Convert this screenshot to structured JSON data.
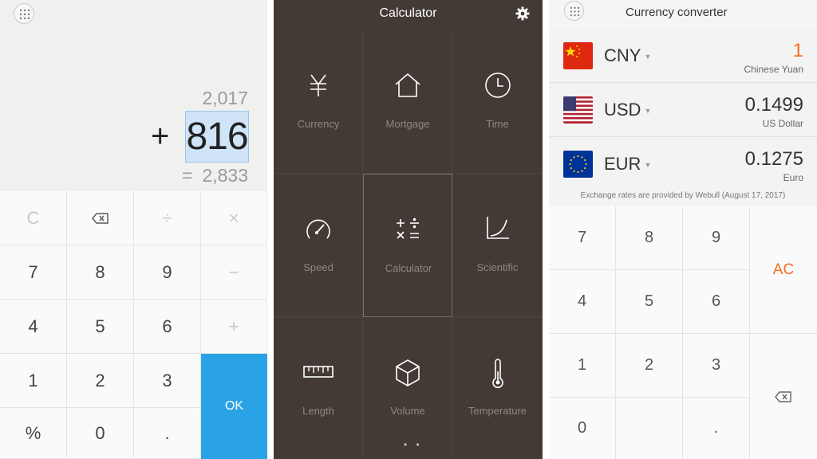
{
  "calculator": {
    "menu_icon": "grid-dots-icon",
    "previous_value": "2,017",
    "operator": "+",
    "current_input": "816",
    "result_prefix": "=",
    "result": "2,833",
    "keys": {
      "clear": "C",
      "backspace_icon": "backspace-icon",
      "divide": "÷",
      "multiply": "×",
      "seven": "7",
      "eight": "8",
      "nine": "9",
      "minus": "−",
      "four": "4",
      "five": "5",
      "six": "6",
      "plus": "+",
      "one": "1",
      "two": "2",
      "three": "3",
      "percent": "%",
      "zero": "0",
      "dot": ".",
      "ok": "OK"
    },
    "accent_color": "#29a3e6"
  },
  "tools": {
    "title": "Calculator",
    "settings_icon": "gear-icon",
    "items": [
      {
        "label": "Currency",
        "icon": "yen-icon"
      },
      {
        "label": "Mortgage",
        "icon": "house-icon"
      },
      {
        "label": "Time",
        "icon": "clock-icon"
      },
      {
        "label": "Speed",
        "icon": "speedometer-icon"
      },
      {
        "label": "Calculator",
        "icon": "calculator-icon"
      },
      {
        "label": "Scientific",
        "icon": "curve-icon"
      },
      {
        "label": "Length",
        "icon": "ruler-icon"
      },
      {
        "label": "Volume",
        "icon": "cube-icon"
      },
      {
        "label": "Temperature",
        "icon": "thermometer-icon"
      }
    ],
    "page_indicator": "• •",
    "background_color": "#433a35"
  },
  "converter": {
    "title": "Currency converter",
    "rows": [
      {
        "code": "CNY",
        "value": "1",
        "name": "Chinese Yuan",
        "flag": "china-flag-icon"
      },
      {
        "code": "USD",
        "value": "0.1499",
        "name": "US Dollar",
        "flag": "usa-flag-icon"
      },
      {
        "code": "EUR",
        "value": "0.1275",
        "name": "Euro",
        "flag": "eu-flag-icon"
      }
    ],
    "note": "Exchange rates are provided by Webull (August 17, 2017)",
    "keys": {
      "seven": "7",
      "eight": "8",
      "nine": "9",
      "four": "4",
      "five": "5",
      "six": "6",
      "one": "1",
      "two": "2",
      "three": "3",
      "zero": "0",
      "dot": ".",
      "ac": "AC",
      "backspace_icon": "backspace-icon"
    },
    "accent_color": "#f36f21"
  }
}
